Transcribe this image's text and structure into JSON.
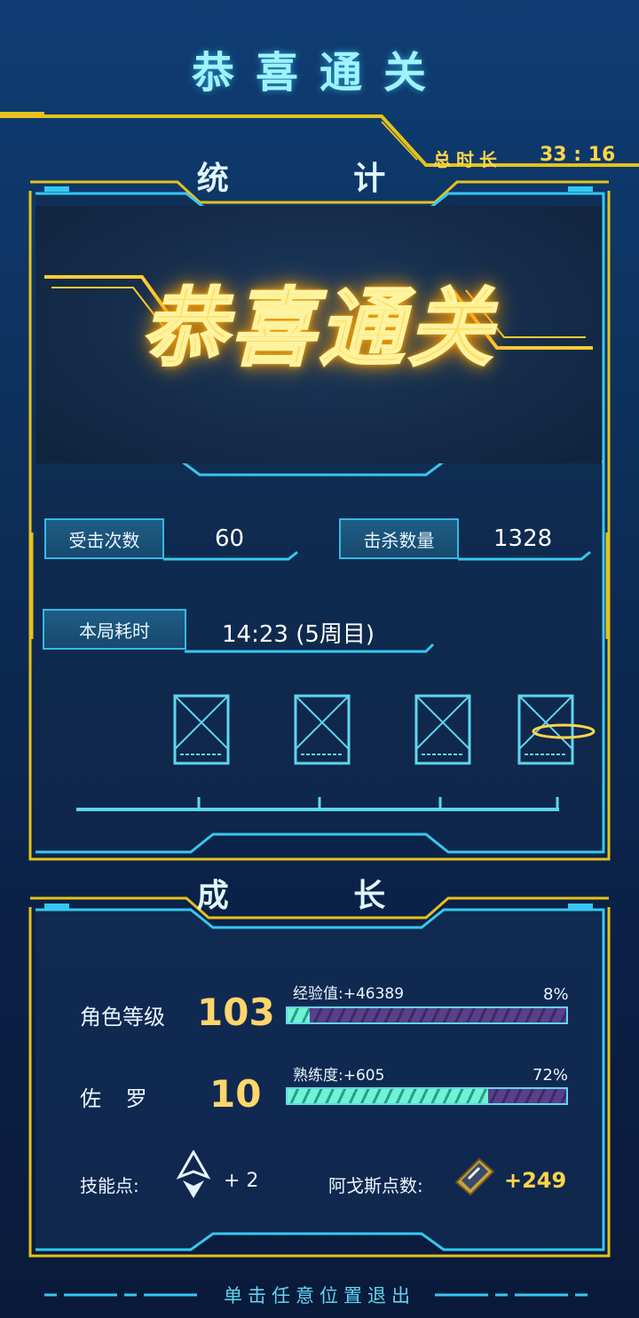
{
  "header": {
    "title": "恭喜通关"
  },
  "total_time": {
    "label": "总时长",
    "value": "33 : 16"
  },
  "stats_section": {
    "title": "统 计",
    "banner_text": "恭喜通关",
    "hits": {
      "label": "受击次数",
      "value": "60"
    },
    "kills": {
      "label": "击杀数量",
      "value": "1328"
    },
    "run_time": {
      "label": "本局耗时",
      "value": "14:23 (5周目)"
    },
    "weapons": [
      "weapon-slot-1",
      "weapon-slot-2",
      "weapon-slot-3",
      "weapon-slot-4"
    ]
  },
  "growth_section": {
    "title": "成 长",
    "char_level": {
      "label": "角色等级",
      "value": "103",
      "bar_caption": "经验值:+46389",
      "percent_text": "8%",
      "fill": 0.08
    },
    "character": {
      "label": "佐 罗",
      "value": "10",
      "bar_caption": "熟练度:+605",
      "percent_text": "72%",
      "fill": 0.72
    },
    "skill_points": {
      "label": "技能点:",
      "value": "+ 2"
    },
    "agos_points": {
      "label": "阿戈斯点数:",
      "value": "+249"
    }
  },
  "footer": {
    "exit_text": "单击任意位置退出"
  },
  "colors": {
    "accent_cyan": "#36c8f0",
    "accent_gold": "#ffd54a",
    "bar_fill": "#6ff4d2"
  }
}
